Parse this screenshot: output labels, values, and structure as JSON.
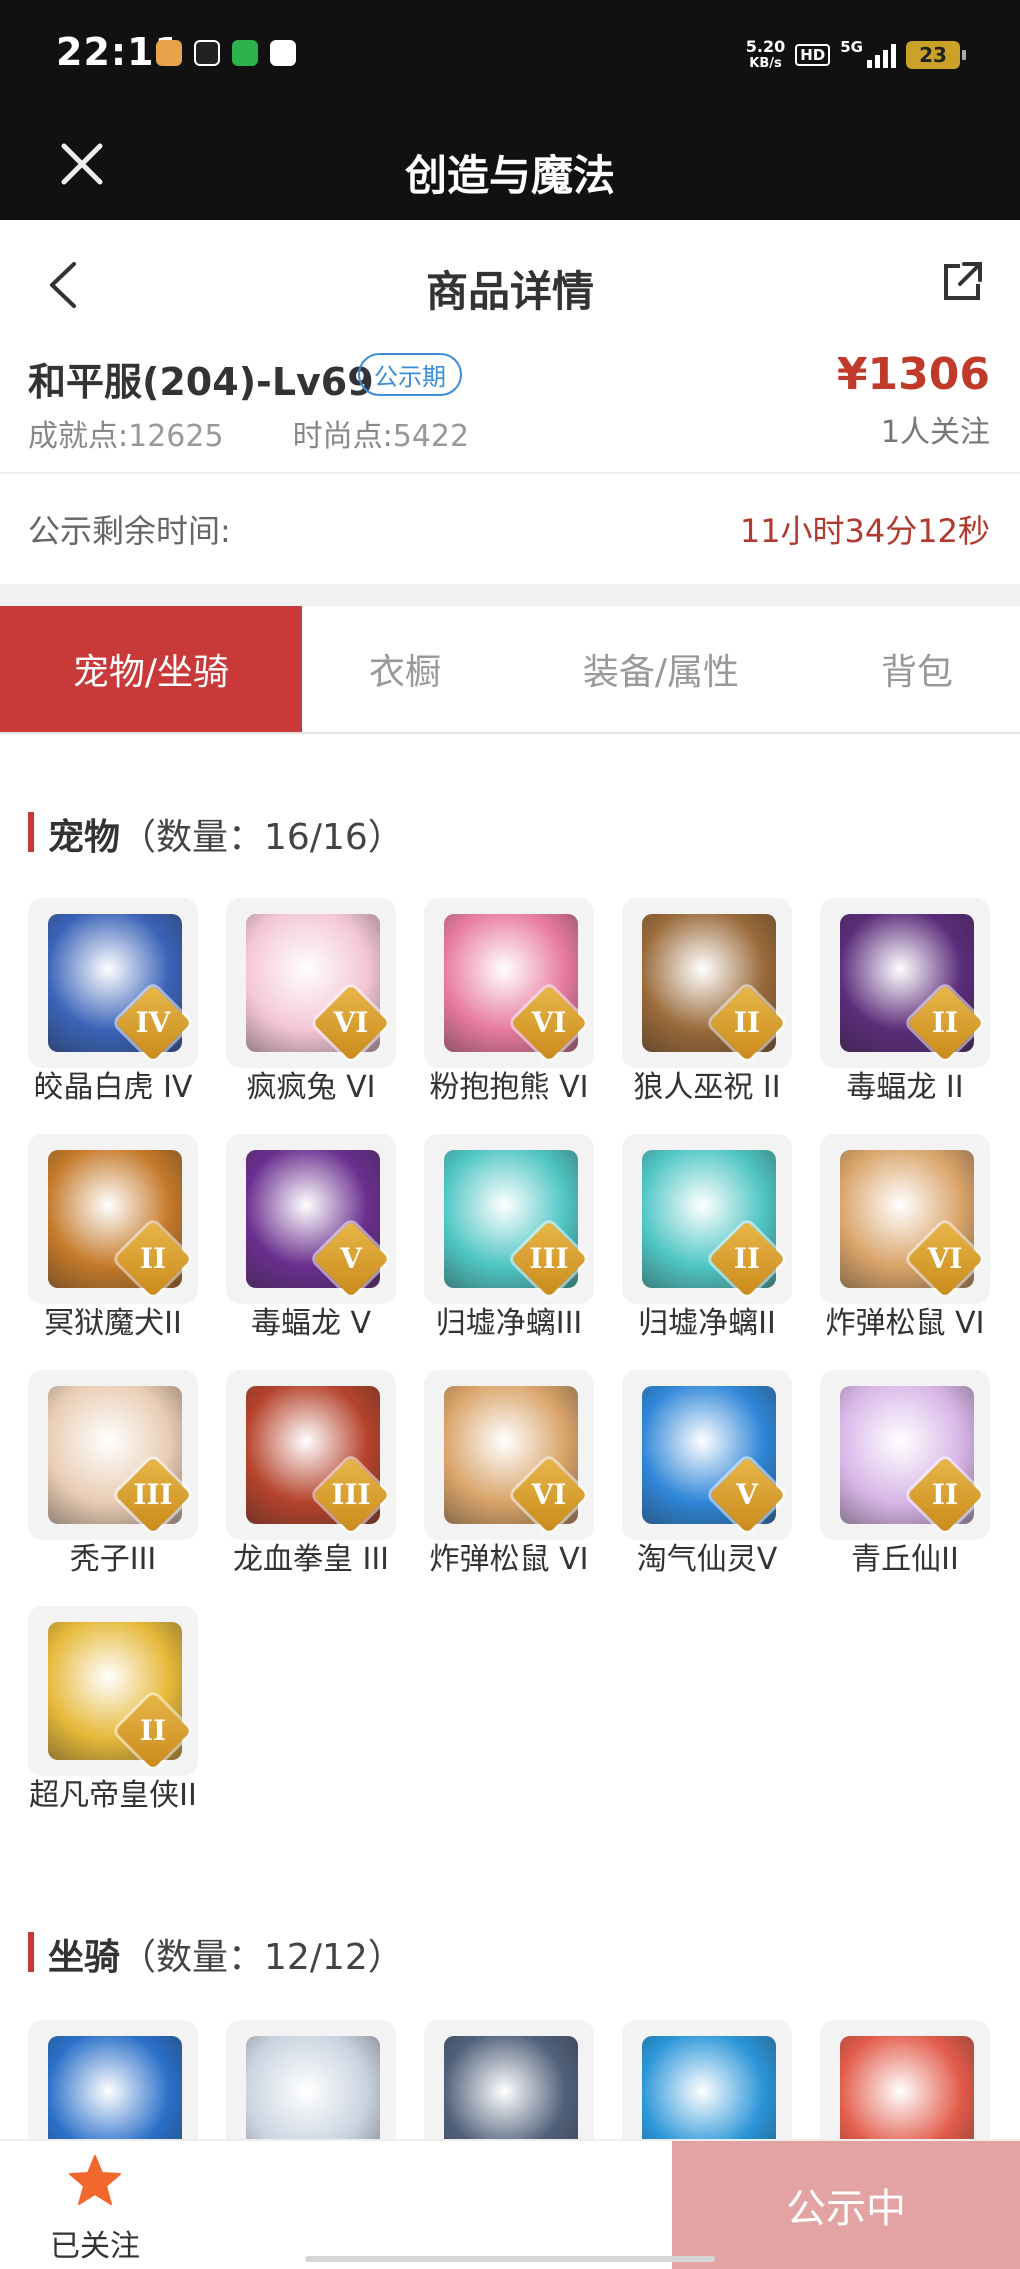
{
  "status_bar": {
    "time": "22:11",
    "speed_value": "5.20",
    "speed_unit": "KB/s",
    "hd": "HD",
    "network": "5G",
    "battery": "23"
  },
  "app_bar": {
    "title": "创造与魔法"
  },
  "nav": {
    "title": "商品详情"
  },
  "summary": {
    "server": "和平服(204)-Lv69",
    "badge": "公示期",
    "achievement_label": "成就点:",
    "achievement_value": "12625",
    "fashion_label": "时尚点:",
    "fashion_value": "5422",
    "price": "¥1306",
    "followers": "1人关注"
  },
  "countdown": {
    "label": "公示剩余时间:",
    "value": "11小时34分12秒"
  },
  "tabs": [
    {
      "label": "宠物/坐骑",
      "active": true
    },
    {
      "label": "衣橱",
      "active": false
    },
    {
      "label": "装备/属性",
      "active": false
    },
    {
      "label": "背包",
      "active": false
    }
  ],
  "pets": {
    "title": "宠物",
    "count": "（数量：16/16）",
    "items": [
      {
        "name": "皎晶白虎 IV",
        "rank": "IV",
        "icon": "white-tiger",
        "color": "#3a63b8"
      },
      {
        "name": "疯疯兔 VI",
        "rank": "VI",
        "icon": "rabbit",
        "color": "#f4c6d6"
      },
      {
        "name": "粉抱抱熊 VI",
        "rank": "VI",
        "icon": "pink-bear",
        "color": "#e77aa0"
      },
      {
        "name": "狼人巫祝 II",
        "rank": "II",
        "icon": "werewolf",
        "color": "#9a6a3a"
      },
      {
        "name": "毒蝠龙 II",
        "rank": "II",
        "icon": "bat-dragon",
        "color": "#5b2c7a"
      },
      {
        "name": "冥狱魔犬II",
        "rank": "II",
        "icon": "hell-hound",
        "color": "#c47a2a"
      },
      {
        "name": "毒蝠龙 V",
        "rank": "V",
        "icon": "bat-dragon",
        "color": "#6a2f8e"
      },
      {
        "name": "归墟净螭III",
        "rank": "III",
        "icon": "jade-dragon",
        "color": "#4fc6c4"
      },
      {
        "name": "归墟净螭II",
        "rank": "II",
        "icon": "jade-dragon",
        "color": "#4fc6c4"
      },
      {
        "name": "炸弹松鼠 VI",
        "rank": "VI",
        "icon": "squirrel",
        "color": "#d9a46a"
      },
      {
        "name": "秃子III",
        "rank": "III",
        "icon": "bald-guy",
        "color": "#e9cdb4"
      },
      {
        "name": "龙血拳皇 III",
        "rank": "III",
        "icon": "dragon-boxer",
        "color": "#b5432c"
      },
      {
        "name": "炸弹松鼠 VI",
        "rank": "VI",
        "icon": "squirrel",
        "color": "#d9a46a"
      },
      {
        "name": "淘气仙灵V",
        "rank": "V",
        "icon": "fairy-pup",
        "color": "#2f86d8"
      },
      {
        "name": "青丘仙II",
        "rank": "II",
        "icon": "fox-fairy",
        "color": "#d8b6e8"
      },
      {
        "name": "超凡帝皇侠II",
        "rank": "II",
        "icon": "golden-hero",
        "color": "#e6b93a"
      }
    ]
  },
  "mounts": {
    "title": "坐骑",
    "count": "（数量：12/12）",
    "items": [
      {
        "icon": "blue-dragon",
        "color": "#2a6fc9"
      },
      {
        "icon": "white-beast",
        "color": "#c9d3e0"
      },
      {
        "icon": "armored-dragon",
        "color": "#50607a"
      },
      {
        "icon": "azure-dragon",
        "color": "#2a95d8"
      },
      {
        "icon": "red-fish",
        "color": "#e25b4a"
      }
    ]
  },
  "bottom": {
    "follow_label": "已关注",
    "cta": "公示中"
  },
  "colors": {
    "accent": "#c9393a",
    "price": "#c0392b",
    "badge": "#3c8ed8",
    "cta": "#e3a3a3",
    "star": "#f2672c"
  }
}
